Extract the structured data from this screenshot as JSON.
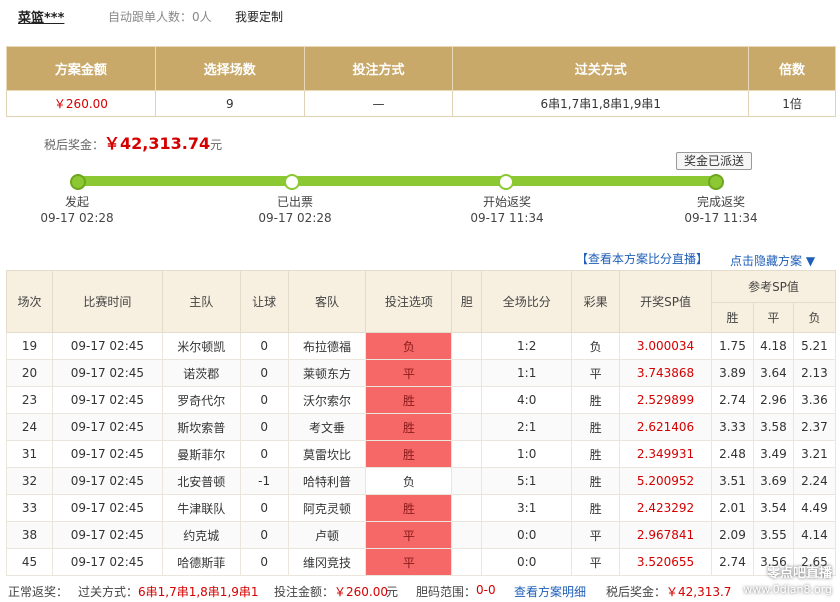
{
  "header": {
    "user": "菜篮***",
    "auto_follow": "自动跟单人数：0人",
    "custom_link": "我要定制"
  },
  "summary": {
    "headers": [
      "方案金额",
      "选择场数",
      "投注方式",
      "过关方式",
      "倍数"
    ],
    "values": [
      "￥260.00",
      "9",
      "—",
      "6串1,7串1,8串1,9串1",
      "1倍"
    ]
  },
  "prize": {
    "label": "税后奖金：",
    "amount": "￥42,313.74",
    "unit": "元",
    "badge": "奖金已派送"
  },
  "steps": [
    {
      "label": "发起",
      "time": "09-17 02:28"
    },
    {
      "label": "已出票",
      "time": "09-17 02:28"
    },
    {
      "label": "开始返奖",
      "time": "09-17 11:34"
    },
    {
      "label": "完成返奖",
      "time": "09-17 11:34"
    }
  ],
  "links": {
    "live": "【查看本方案比分直播】",
    "hide": "点击隐藏方案 ▼"
  },
  "table": {
    "headers": {
      "no": "场次",
      "time": "比赛时间",
      "home": "主队",
      "handicap": "让球",
      "away": "客队",
      "pick": "投注选项",
      "dan": "胆",
      "score": "全场比分",
      "result": "彩果",
      "sp": "开奖SP值",
      "ref": "参考SP值",
      "win": "胜",
      "draw": "平",
      "lose": "负"
    },
    "rows": [
      {
        "no": "19",
        "time": "09-17 02:45",
        "home": "米尔顿凯",
        "handicap": "0",
        "away": "布拉德福",
        "pick": "负",
        "dan": "",
        "score": "1:2",
        "result": "负",
        "sp": "3.000034",
        "win": "1.75",
        "draw": "4.18",
        "lose": "5.21"
      },
      {
        "no": "20",
        "time": "09-17 02:45",
        "home": "诺茨郡",
        "handicap": "0",
        "away": "莱顿东方",
        "pick": "平",
        "dan": "",
        "score": "1:1",
        "result": "平",
        "sp": "3.743868",
        "win": "3.89",
        "draw": "3.64",
        "lose": "2.13"
      },
      {
        "no": "23",
        "time": "09-17 02:45",
        "home": "罗奇代尔",
        "handicap": "0",
        "away": "沃尔索尔",
        "pick": "胜",
        "dan": "",
        "score": "4:0",
        "result": "胜",
        "sp": "2.529899",
        "win": "2.74",
        "draw": "2.96",
        "lose": "3.36"
      },
      {
        "no": "24",
        "time": "09-17 02:45",
        "home": "斯坎索普",
        "handicap": "0",
        "away": "考文垂",
        "pick": "胜",
        "dan": "",
        "score": "2:1",
        "result": "胜",
        "sp": "2.621406",
        "win": "3.33",
        "draw": "3.58",
        "lose": "2.37"
      },
      {
        "no": "31",
        "time": "09-17 02:45",
        "home": "曼斯菲尔",
        "handicap": "0",
        "away": "莫雷坎比",
        "pick": "胜",
        "dan": "",
        "score": "1:0",
        "result": "胜",
        "sp": "2.349931",
        "win": "2.48",
        "draw": "3.49",
        "lose": "3.21"
      },
      {
        "no": "32",
        "time": "09-17 02:45",
        "home": "北安普顿",
        "handicap": "-1",
        "away": "哈特利普",
        "pick": "负",
        "dan": "",
        "score": "5:1",
        "result": "胜",
        "sp": "5.200952",
        "win": "3.51",
        "draw": "3.69",
        "lose": "2.24"
      },
      {
        "no": "33",
        "time": "09-17 02:45",
        "home": "牛津联队",
        "handicap": "0",
        "away": "阿克灵顿",
        "pick": "胜",
        "dan": "",
        "score": "3:1",
        "result": "胜",
        "sp": "2.423292",
        "win": "2.01",
        "draw": "3.54",
        "lose": "4.49"
      },
      {
        "no": "38",
        "time": "09-17 02:45",
        "home": "约克城",
        "handicap": "0",
        "away": "卢顿",
        "pick": "平",
        "dan": "",
        "score": "0:0",
        "result": "平",
        "sp": "2.967841",
        "win": "2.09",
        "draw": "3.55",
        "lose": "4.14"
      },
      {
        "no": "45",
        "time": "09-17 02:45",
        "home": "哈德斯菲",
        "handicap": "0",
        "away": "维冈竞技",
        "pick": "平",
        "dan": "",
        "score": "0:0",
        "result": "平",
        "sp": "3.520655",
        "win": "2.74",
        "draw": "3.56",
        "lose": "2.65"
      }
    ]
  },
  "footer": {
    "status": "正常返奖：",
    "pass_label": "过关方式：",
    "pass_value": "6串1,7串1,8串1,9串1",
    "bet_label": "投注金额：",
    "bet_value": "￥260.00",
    "bet_unit": "元",
    "dan_label": "胆码范围：",
    "dan_value": "0-0",
    "detail_link": "查看方案明细",
    "prize_label": "税后奖金：",
    "prize_value": "￥42,313.7"
  },
  "watermark": {
    "name": "零点吧直播",
    "url": "www.0dian8.org"
  },
  "colors": {
    "header_gold": "#c8a96a",
    "progress_green": "#8bc832",
    "pick_red": "#f66767",
    "price_red": "#d40000",
    "link_blue": "#1f5fb8"
  }
}
